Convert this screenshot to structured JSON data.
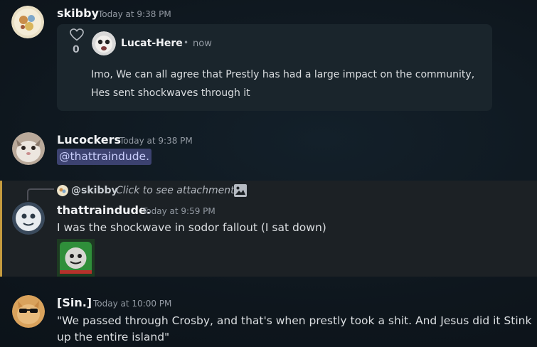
{
  "messages": [
    {
      "username": "skibby",
      "timestamp": "Today at 9:38 PM",
      "embed": {
        "like_count": "0",
        "author": "Lucat-Here",
        "separator": "•",
        "time": "now",
        "line1": "Imo, We can all agree that Prestly has had a large impact on the community,",
        "line2": "Hes sent shockwaves through it"
      }
    },
    {
      "username": "Lucockers",
      "timestamp": "Today at 9:38 PM",
      "mention": "@thattraindude."
    },
    {
      "reply_to": "@skibby",
      "reply_preview": "Click to see attachment",
      "username": "thattraindude.",
      "timestamp": "Today at 9:59 PM",
      "text": "I was the shockwave in sodor fallout (I sat down)"
    },
    {
      "username": "[Sin.]",
      "timestamp": "Today at 10:00 PM",
      "line1": "\"We passed through Crosby, and that's when prestly took a shit. And Jesus did it Stink",
      "line2": "up the entire island\""
    }
  ],
  "colors": {
    "background": "#0e161d",
    "mention_bg": "#3c4270",
    "highlight_bar": "#c59b3e"
  }
}
